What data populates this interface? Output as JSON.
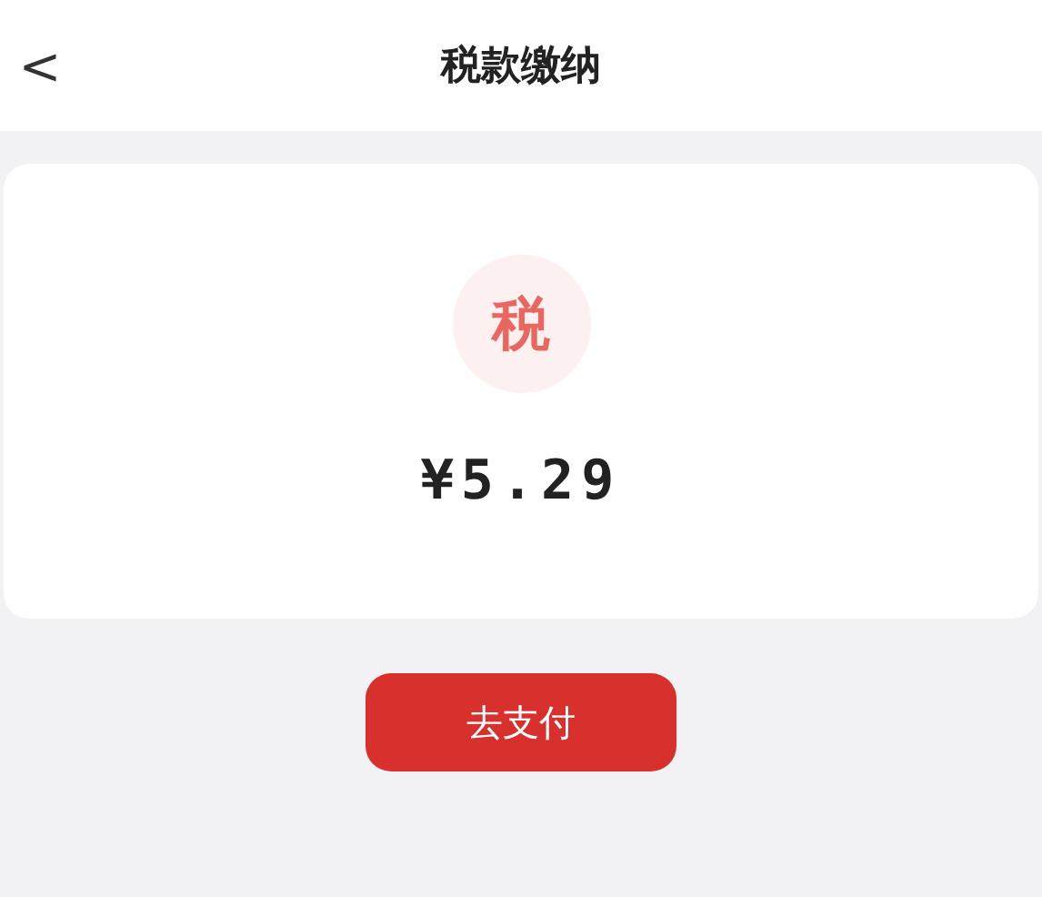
{
  "header": {
    "back": "<",
    "title": "税款缴纳"
  },
  "card": {
    "badge": "税",
    "amount": "¥5.29"
  },
  "pay_button": "去支付"
}
